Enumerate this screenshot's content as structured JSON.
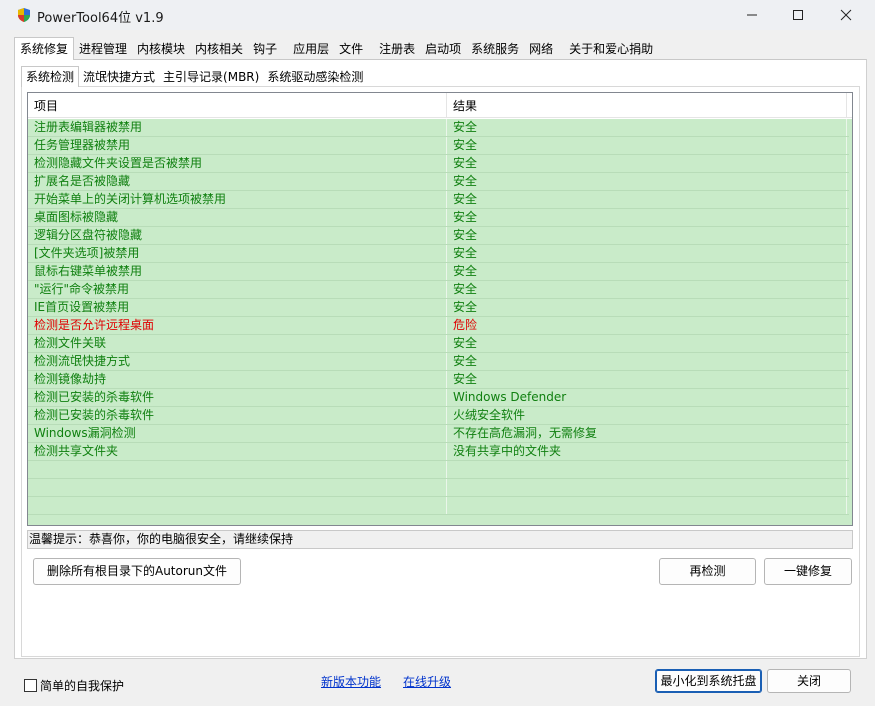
{
  "window": {
    "title": "PowerTool64位 v1.9"
  },
  "main_tabs": [
    {
      "label": "系统修复",
      "active": true
    },
    {
      "label": "进程管理"
    },
    {
      "label": "内核模块"
    },
    {
      "label": "内核相关"
    },
    {
      "label": "钩子"
    },
    {
      "label": "应用层"
    },
    {
      "label": "文件"
    },
    {
      "label": "注册表"
    },
    {
      "label": "启动项"
    },
    {
      "label": "系统服务"
    },
    {
      "label": "网络"
    },
    {
      "label": "关于和爱心捐助"
    }
  ],
  "sub_tabs": [
    {
      "label": "系统检测",
      "active": true
    },
    {
      "label": "流氓快捷方式"
    },
    {
      "label": "主引导记录(MBR)"
    },
    {
      "label": "系统驱动感染检测"
    }
  ],
  "table": {
    "columns": [
      "项目",
      "结果"
    ],
    "rows": [
      {
        "item": "注册表编辑器被禁用",
        "result": "安全",
        "status": "ok"
      },
      {
        "item": "任务管理器被禁用",
        "result": "安全",
        "status": "ok"
      },
      {
        "item": "检测隐藏文件夹设置是否被禁用",
        "result": "安全",
        "status": "ok"
      },
      {
        "item": "扩展名是否被隐藏",
        "result": "安全",
        "status": "ok"
      },
      {
        "item": "开始菜单上的关闭计算机选项被禁用",
        "result": "安全",
        "status": "ok"
      },
      {
        "item": "桌面图标被隐藏",
        "result": "安全",
        "status": "ok"
      },
      {
        "item": "逻辑分区盘符被隐藏",
        "result": "安全",
        "status": "ok"
      },
      {
        "item": "[文件夹选项]被禁用",
        "result": "安全",
        "status": "ok"
      },
      {
        "item": "鼠标右键菜单被禁用",
        "result": "安全",
        "status": "ok"
      },
      {
        "item": "\"运行\"命令被禁用",
        "result": "安全",
        "status": "ok"
      },
      {
        "item": "IE首页设置被禁用",
        "result": "安全",
        "status": "ok"
      },
      {
        "item": "检测是否允许远程桌面",
        "result": "危险",
        "status": "bad"
      },
      {
        "item": "检测文件关联",
        "result": "安全",
        "status": "ok"
      },
      {
        "item": "检测流氓快捷方式",
        "result": "安全",
        "status": "ok"
      },
      {
        "item": "检测镜像劫持",
        "result": "安全",
        "status": "ok"
      },
      {
        "item": "检测已安装的杀毒软件",
        "result": "Windows Defender",
        "status": "ok"
      },
      {
        "item": "检测已安装的杀毒软件",
        "result": "火绒安全软件",
        "status": "ok"
      },
      {
        "item": "Windows漏洞检测",
        "result": "不存在高危漏洞，无需修复",
        "status": "ok"
      },
      {
        "item": "检测共享文件夹",
        "result": "没有共享中的文件夹",
        "status": "ok"
      },
      {
        "item": "",
        "result": "",
        "status": "ok"
      },
      {
        "item": "",
        "result": "",
        "status": "ok"
      },
      {
        "item": "",
        "result": "",
        "status": "ok"
      }
    ]
  },
  "hint": "温馨提示：恭喜你，你的电脑很安全，请继续保持",
  "buttons": {
    "delete_autorun": "删除所有根目录下的Autorun文件",
    "recheck": "再检测",
    "one_click_fix": "一键修复",
    "minimize_tray": "最小化到系统托盘",
    "close": "关闭"
  },
  "checkbox": {
    "self_protect": "简单的自我保护",
    "checked": false
  },
  "links": {
    "new_features": "新版本功能",
    "online_upgrade": "在线升级"
  },
  "colors": {
    "row_bg": "#c9ebc9",
    "ok_text": "#108010",
    "bad_text": "#e00000",
    "link": "#0033cc"
  }
}
